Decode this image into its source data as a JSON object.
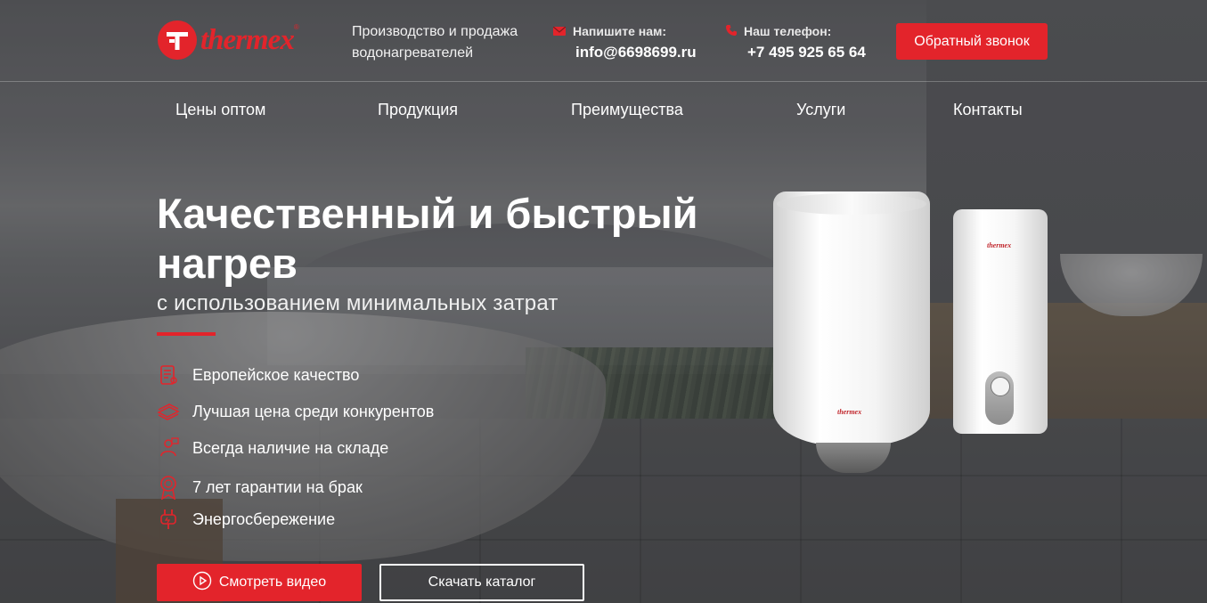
{
  "header": {
    "logo_text": "thermex",
    "tagline": "Производство и продажа водонагревателей",
    "email_label": "Напишите нам:",
    "email": "info@6698699.ru",
    "phone_label": "Наш телефон:",
    "phone": "+7 495 925 65 64",
    "callback_label": "Обратный звонок"
  },
  "nav": {
    "items": [
      {
        "label": "Цены оптом"
      },
      {
        "label": "Продукция"
      },
      {
        "label": "Преимущества"
      },
      {
        "label": "Услуги"
      },
      {
        "label": "Контакты"
      }
    ]
  },
  "hero": {
    "title": "Качественный и быстрый нагрев",
    "subtitle": "с использованием минимальных затрат",
    "features": [
      {
        "icon": "certificate-icon",
        "label": "Европейское качество"
      },
      {
        "icon": "money-stack-icon",
        "label": "Лучшая цена среди конкурентов"
      },
      {
        "icon": "warehouse-worker-icon",
        "label": "Всегда наличие на складе"
      },
      {
        "icon": "award-ribbon-icon",
        "label": "7 лет гарантии на брак"
      },
      {
        "icon": "plug-icon",
        "label": "Энергосбережение"
      }
    ],
    "video_button": "Смотреть видео",
    "catalog_button": "Скачать каталог"
  },
  "colors": {
    "accent": "#e3242b",
    "text": "#ffffff"
  }
}
